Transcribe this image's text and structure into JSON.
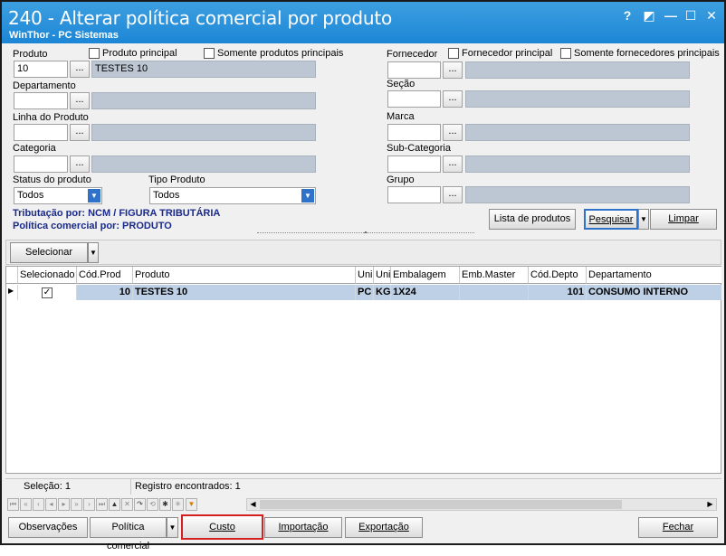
{
  "window": {
    "title": "240 - Alterar política comercial por produto",
    "subtitle": "WinThor - PC Sistemas",
    "controls": [
      "?",
      "◩",
      "—",
      "☐",
      "✕"
    ]
  },
  "filters": {
    "produto_label": "Produto",
    "produto_principal": "Produto principal",
    "somente_produtos_principais": "Somente produtos principais",
    "produto_code": "10",
    "produto_desc": "TESTES 10",
    "departamento_label": "Departamento",
    "linha_label": "Linha do Produto",
    "categoria_label": "Categoria",
    "status_label": "Status do produto",
    "status_value": "Todos",
    "tipo_label": "Tipo Produto",
    "tipo_value": "Todos",
    "fornecedor_label": "Fornecedor",
    "fornecedor_principal": "Fornecedor principal",
    "somente_fornecedores_principais": "Somente fornecedores principais",
    "secao_label": "Seção",
    "marca_label": "Marca",
    "subcategoria_label": "Sub-Categoria",
    "grupo_label": "Grupo",
    "dots": "..."
  },
  "info": {
    "tributacao": "Tributação por: NCM / FIGURA TRIBUTÁRIA",
    "politica": "Política comercial por: PRODUTO"
  },
  "actions": {
    "lista_produtos": "Lista de produtos",
    "pesquisar": "Pesquisar",
    "limpar": "Limpar",
    "selecionar": "Selecionar"
  },
  "grid": {
    "columns": [
      "Selecionado",
      "Cód.Prod",
      "Produto",
      "Uni",
      "Uni",
      "Embalagem",
      "Emb.Master",
      "Cód.Depto",
      "Departamento"
    ],
    "rows": [
      {
        "selecionado": true,
        "cod": "10",
        "produto": "TESTES 10",
        "uni1": "PC",
        "uni2": "KG",
        "embalagem": "1X24",
        "emb_master": "",
        "cod_depto": "101",
        "departamento": "CONSUMO INTERNO"
      }
    ]
  },
  "status": {
    "selecao": "Seleção: 1",
    "registros": "Registro encontrados: 1"
  },
  "footer": {
    "observacoes": "Observações",
    "politica_comercial": "Política comercial",
    "custo": "Custo",
    "importacao": "Importação",
    "exportacao": "Exportação",
    "fechar": "Fechar"
  },
  "colors": {
    "title_bg": "#1c86d6",
    "highlight": "#d42020",
    "row_selected": "#bdd0e6",
    "info_text": "#1a2a8a"
  }
}
